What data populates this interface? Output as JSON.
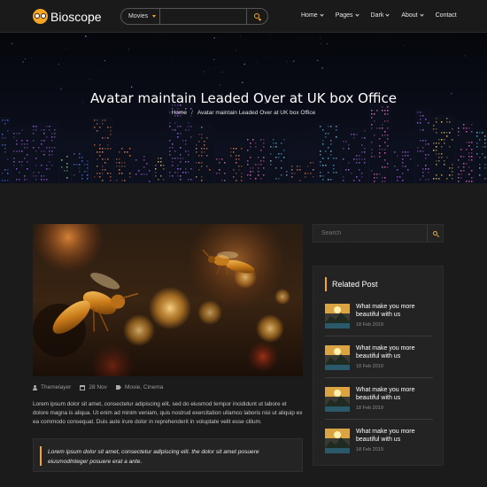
{
  "brand": {
    "name": "Bioscope"
  },
  "search": {
    "category": "Movies",
    "placeholder": ""
  },
  "nav": [
    {
      "label": "Home",
      "has_dropdown": true
    },
    {
      "label": "Pages",
      "has_dropdown": true
    },
    {
      "label": "Dark",
      "has_dropdown": true
    },
    {
      "label": "About",
      "has_dropdown": true
    },
    {
      "label": "Contact",
      "has_dropdown": false
    }
  ],
  "hero": {
    "title": "Avatar maintain Leaded Over at UK box Office",
    "breadcrumb": {
      "home": "Home",
      "separator": "/",
      "current": "Avatar maintain Leaded Over at UK box Office"
    }
  },
  "post": {
    "meta": {
      "author": "Themelayer",
      "date": "28 Nov",
      "categories": "Movie, Cinema"
    },
    "body": "Lorem ipsum dolor sit amet, consectetur adipiscing elit, sed do eiusmod tempor incididunt ut labore et dolore magna is aliqua. Ut enim ad minim veniam, quis nostrud exercitation ullamco laboris nisi ut aliquip ex ea commodo consequat. Duis aute irure dolor in reprehenderit in voluptate velit esse cillum.",
    "quote": "Lorem ipsum dolor sit amet, consectetur adipiscing elit. the dolor sit amet posuere eiusmodInteger posuere erat a ante."
  },
  "sidebar": {
    "search_placeholder": "Search",
    "related_title": "Related Post",
    "related": [
      {
        "title": "What make you more beautiful with us",
        "date": "18 Feb 2019"
      },
      {
        "title": "What make you more beautiful with us",
        "date": "18 Feb 2019"
      },
      {
        "title": "What make you more beautiful with us",
        "date": "18 Feb 2019"
      },
      {
        "title": "What make you more beautiful with us",
        "date": "18 Feb 2019"
      }
    ]
  },
  "colors": {
    "accent": "#f5a623",
    "background": "#1b1b1b",
    "panel": "#232323"
  },
  "icons": [
    "search-icon",
    "user-icon",
    "calendar-icon",
    "tag-icon",
    "chevron-down-icon"
  ]
}
